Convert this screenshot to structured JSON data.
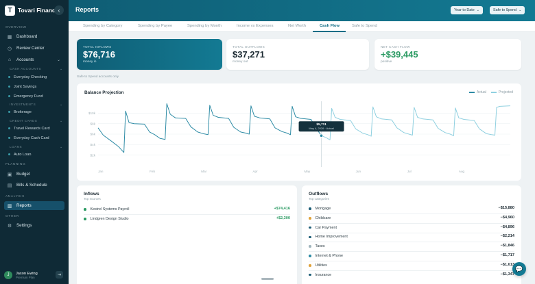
{
  "brand": {
    "logo_letter": "T",
    "name": "Tovari Financial",
    "collapse_icon": "chevron-left-icon"
  },
  "sidebar": {
    "sections": {
      "overview": "OVERVIEW",
      "cash_accounts": "CASH ACCOUNTS",
      "investments": "INVESTMENTS",
      "credit_cards": "CREDIT CARDS",
      "loans": "LOANS",
      "planning": "PLANNING",
      "analysis": "ANALYSIS",
      "other": "OTHER"
    },
    "items": {
      "dashboard": "Dashboard",
      "review_center": "Review Center",
      "accounts": "Accounts",
      "budget": "Budget",
      "bills": "Bills & Schedule",
      "reports": "Reports",
      "settings": "Settings"
    },
    "cash_accounts": [
      "Everyday Checking",
      "Joint Savings",
      "Emergency Fund"
    ],
    "investments": [
      "Brokerage"
    ],
    "credit_cards": [
      "Travel Rewards Card",
      "Everyday Cash Card"
    ],
    "loans": [
      "Auto Loan"
    ]
  },
  "user": {
    "initial": "J",
    "name": "Jason Ewing",
    "role": "Premium Plan"
  },
  "header": {
    "title": "Reports",
    "period": "Year to Date",
    "scope": "Safe to Spend"
  },
  "tabs": [
    "Spending by Category",
    "Spending by Payee",
    "Spending by Month",
    "Income vs Expenses",
    "Net Worth",
    "Cash Flow",
    "Safe to Spend"
  ],
  "active_tab": "Cash Flow",
  "kpis": [
    {
      "label": "TOTAL INFLOWS",
      "value": "$76,716",
      "sub": "money in"
    },
    {
      "label": "TOTAL OUTFLOWS",
      "value": "$37,271",
      "sub": "money out"
    },
    {
      "label": "NET CASH FLOW",
      "value": "+$39,445",
      "sub": "positive"
    }
  ],
  "note": "Safe to Spend accounts only",
  "chart_data": {
    "type": "line",
    "title": "Balance Projection",
    "legend": [
      "Actual",
      "Projected"
    ],
    "legend_placement": "top-right",
    "ylim": [
      0,
      12000
    ],
    "yticks": [
      "$2k",
      "$4k",
      "$6k",
      "$8k",
      "$10k"
    ],
    "months": [
      "Jan",
      "Feb",
      "Mar",
      "Apr",
      "May",
      "Jun",
      "Jul",
      "Aug"
    ],
    "x_range": [
      0,
      240
    ],
    "today_day": 130,
    "tooltip": {
      "value": "$5,711",
      "label": "May 4, 2026 · Actual"
    },
    "colors": {
      "actual": "#2d8ba5",
      "projected": "#8fd0e0"
    },
    "series": [
      {
        "name": "Actual",
        "points": [
          [
            0,
            7200
          ],
          [
            3,
            5800
          ],
          [
            8,
            4600
          ],
          [
            12,
            3600
          ],
          [
            15,
            2500
          ],
          [
            16,
            10400
          ],
          [
            18,
            8200
          ],
          [
            21,
            8000
          ],
          [
            27,
            7900
          ],
          [
            30,
            6400
          ],
          [
            33,
            5900
          ],
          [
            36,
            5200
          ],
          [
            39,
            5000
          ],
          [
            40,
            11800
          ],
          [
            42,
            9800
          ],
          [
            45,
            9100
          ],
          [
            51,
            9000
          ],
          [
            54,
            7400
          ],
          [
            58,
            6400
          ],
          [
            61,
            6100
          ],
          [
            64,
            5900
          ],
          [
            65,
            11500
          ],
          [
            67,
            9600
          ],
          [
            70,
            9200
          ],
          [
            76,
            9000
          ],
          [
            79,
            7300
          ],
          [
            83,
            6400
          ],
          [
            86,
            6200
          ],
          [
            88,
            6000
          ],
          [
            89,
            11400
          ],
          [
            91,
            9400
          ],
          [
            94,
            9100
          ],
          [
            100,
            8900
          ],
          [
            103,
            7200
          ],
          [
            107,
            6500
          ],
          [
            110,
            6200
          ],
          [
            112,
            5900
          ],
          [
            113,
            11300
          ],
          [
            115,
            9300
          ],
          [
            118,
            9000
          ],
          [
            124,
            8800
          ],
          [
            127,
            7100
          ],
          [
            130,
            5711
          ]
        ]
      },
      {
        "name": "Projected",
        "points": [
          [
            130,
            5711
          ],
          [
            133,
            5300
          ],
          [
            135,
            4900
          ],
          [
            136,
            10900
          ],
          [
            138,
            9200
          ],
          [
            141,
            8800
          ],
          [
            147,
            8600
          ],
          [
            150,
            7000
          ],
          [
            154,
            6200
          ],
          [
            157,
            5900
          ],
          [
            159,
            5600
          ],
          [
            160,
            11200
          ],
          [
            162,
            9300
          ],
          [
            165,
            8900
          ],
          [
            171,
            8700
          ],
          [
            174,
            7200
          ],
          [
            178,
            6300
          ],
          [
            181,
            6000
          ],
          [
            183,
            5800
          ],
          [
            184,
            11100
          ],
          [
            186,
            9200
          ],
          [
            189,
            8900
          ],
          [
            195,
            8700
          ],
          [
            198,
            7100
          ],
          [
            202,
            6300
          ],
          [
            205,
            6000
          ],
          [
            207,
            5700
          ],
          [
            208,
            11000
          ],
          [
            210,
            9100
          ],
          [
            213,
            8800
          ],
          [
            219,
            8600
          ],
          [
            222,
            7000
          ],
          [
            226,
            6100
          ],
          [
            229,
            5900
          ],
          [
            231,
            5800
          ],
          [
            232,
            11100
          ],
          [
            234,
            11300
          ],
          [
            240,
            11400
          ]
        ]
      }
    ]
  },
  "inflows": {
    "title": "Inflows",
    "sub": "Top sources",
    "rows": [
      {
        "name": "Kestrel Systems Payroll",
        "amount": "+$74,416",
        "color": "#2a9a62"
      },
      {
        "name": "Lindgren Design Studio",
        "amount": "+$2,300",
        "color": "#2a9a62"
      }
    ]
  },
  "outflows": {
    "title": "Outflows",
    "sub": "Top categories",
    "rows": [
      {
        "name": "Mortgage",
        "amount": "−$15,880",
        "color": "#1f5f78"
      },
      {
        "name": "Childcare",
        "amount": "−$4,960",
        "color": "#e0a23a"
      },
      {
        "name": "Car Payment",
        "amount": "−$4,896",
        "color": "#1f5f78"
      },
      {
        "name": "Home Improvement",
        "amount": "−$2,214",
        "color": "#1f5f78"
      },
      {
        "name": "Taxes",
        "amount": "−$1,846",
        "color": "#9fb4bc"
      },
      {
        "name": "Internet & Phone",
        "amount": "−$1,717",
        "color": "#2d8ba5"
      },
      {
        "name": "Utilities",
        "amount": "−$1,613",
        "color": "#e0a23a"
      },
      {
        "name": "Insurance",
        "amount": "−$1,347",
        "color": "#1f5f78"
      }
    ]
  }
}
